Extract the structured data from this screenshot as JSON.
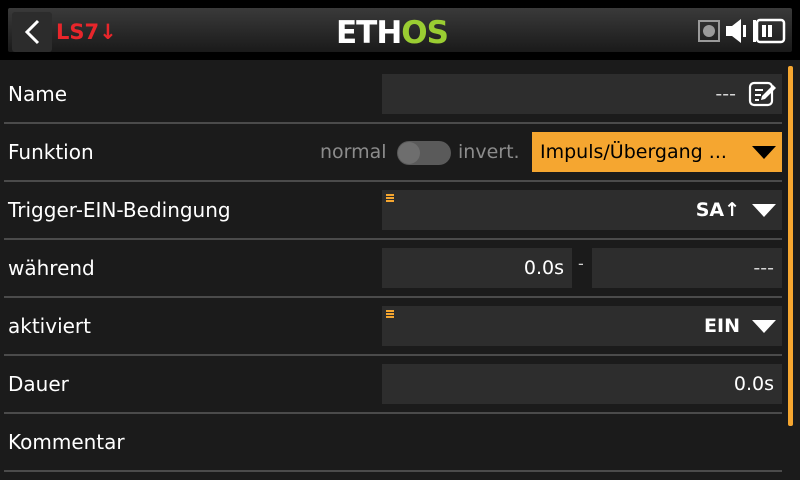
{
  "header": {
    "back_icon": "chevron-left-icon",
    "switch_label": "LS7",
    "switch_arrow": "↓",
    "logo_part1": "ETH",
    "logo_part2": "OS",
    "status_icons": [
      "sd-card-icon",
      "speaker-icon",
      "battery-icon"
    ]
  },
  "rows": {
    "name": {
      "label": "Name",
      "value": "---",
      "edit_icon": "edit-icon"
    },
    "function": {
      "label": "Funktion",
      "toggle_left": "normal",
      "toggle_right": "invert.",
      "selected": "Impuls/Übergang ..."
    },
    "trigger": {
      "label": "Trigger-EIN-Bedingung",
      "value": "SA↑"
    },
    "during": {
      "label": "während",
      "from_value": "0.0s",
      "separator": "-",
      "to_value": "---"
    },
    "activated": {
      "label": "aktiviert",
      "value": "EIN"
    },
    "duration": {
      "label": "Dauer",
      "value": "0.0s"
    },
    "comment": {
      "label": "Kommentar"
    }
  },
  "colors": {
    "accent": "#f5a630",
    "switch_label": "#e8262b",
    "logo_os": "#9acd32",
    "background": "#1b1b1b",
    "field": "#2d2d2d"
  }
}
